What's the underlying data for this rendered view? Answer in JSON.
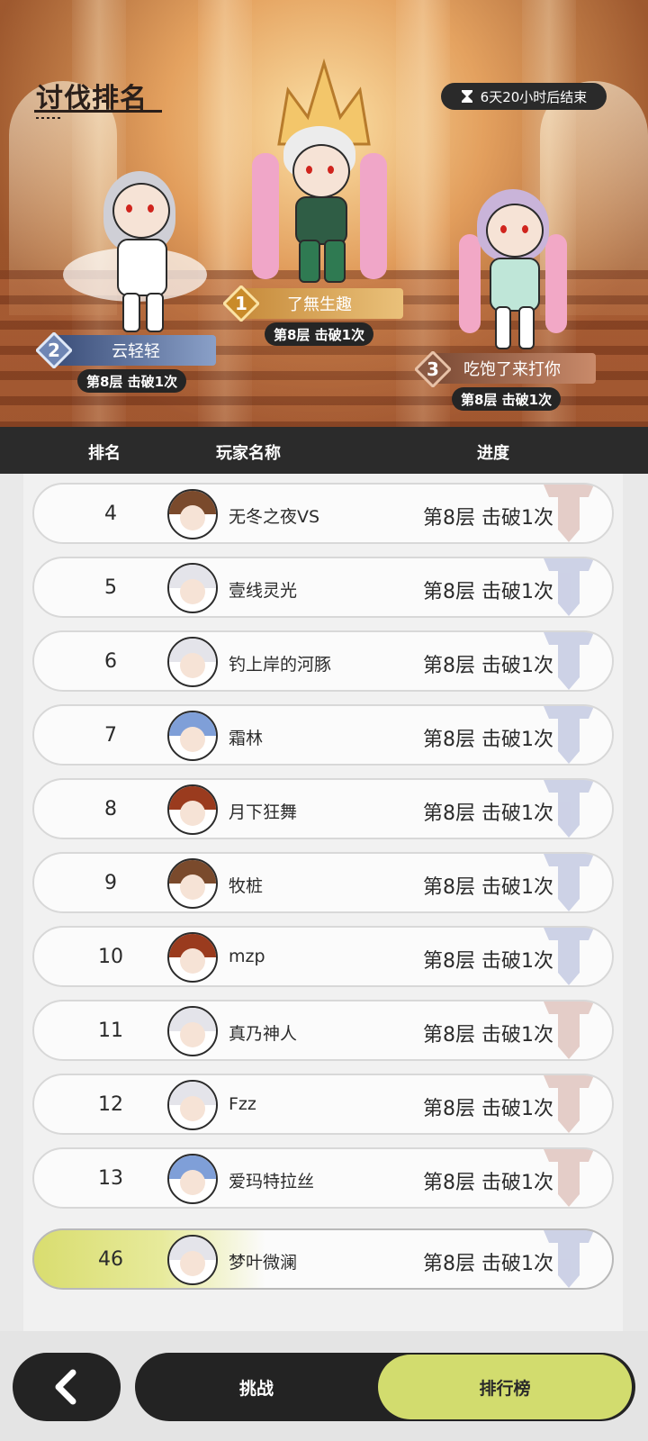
{
  "page": {
    "title": "讨伐排名",
    "timer_text": "6天20小时后结束"
  },
  "podium": [
    {
      "rank": "1",
      "name": "了無生趣",
      "progress": "第8层 击破1次"
    },
    {
      "rank": "2",
      "name": "云轻轻",
      "progress": "第8层 击破1次"
    },
    {
      "rank": "3",
      "name": "吃饱了来打你",
      "progress": "第8层 击破1次"
    }
  ],
  "table": {
    "headers": {
      "rank": "排名",
      "player": "玩家名称",
      "progress": "进度"
    },
    "rows": [
      {
        "rank": "4",
        "name": "无冬之夜VS",
        "progress": "第8层 击破1次",
        "avatar": "brown-hair-avatar",
        "emblem_color": "#b97a6a"
      },
      {
        "rank": "5",
        "name": "壹线灵光",
        "progress": "第8层 击破1次",
        "avatar": "white-hair-avatar",
        "emblem_color": "#7a86c0"
      },
      {
        "rank": "6",
        "name": "钓上岸的河豚",
        "progress": "第8层 击破1次",
        "avatar": "white-hair-avatar",
        "emblem_color": "#7a86c0"
      },
      {
        "rank": "7",
        "name": "霜林",
        "progress": "第8层 击破1次",
        "avatar": "blue-hair-avatar",
        "emblem_color": "#7a86c0"
      },
      {
        "rank": "8",
        "name": "月下狂舞",
        "progress": "第8层 击破1次",
        "avatar": "witch-hat-avatar",
        "emblem_color": "#7a86c0"
      },
      {
        "rank": "9",
        "name": "牧桩",
        "progress": "第8层 击破1次",
        "avatar": "brown-hair-avatar",
        "emblem_color": "#7a86c0"
      },
      {
        "rank": "10",
        "name": "mzp",
        "progress": "第8层 击破1次",
        "avatar": "witch-hat-avatar",
        "emblem_color": "#7a86c0"
      },
      {
        "rank": "11",
        "name": "真乃神人",
        "progress": "第8层 击破1次",
        "avatar": "white-hair-avatar",
        "emblem_color": "#b97a6a"
      },
      {
        "rank": "12",
        "name": "Fzz",
        "progress": "第8层 击破1次",
        "avatar": "white-hair-avatar",
        "emblem_color": "#b97a6a"
      },
      {
        "rank": "13",
        "name": "爱玛特拉丝",
        "progress": "第8层 击破1次",
        "avatar": "blue-hair-avatar",
        "emblem_color": "#b97a6a"
      }
    ],
    "self": {
      "rank": "46",
      "name": "梦叶微澜",
      "progress": "第8层 击破1次",
      "avatar": "white-hair-avatar",
      "emblem_color": "#7a86c0"
    }
  },
  "bottom": {
    "back_icon": "chevron-left-icon",
    "tabs": {
      "challenge": "挑战",
      "ranking": "排行榜"
    }
  },
  "colors": {
    "accent": "#d2dc6e",
    "dark": "#232323"
  }
}
